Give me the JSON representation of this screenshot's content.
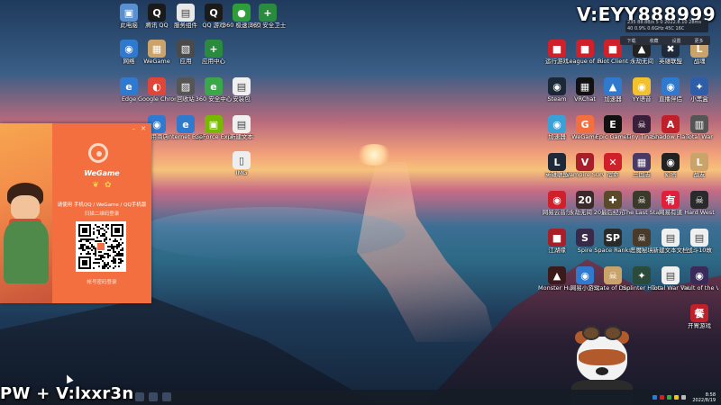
{
  "overlays": {
    "top_right": "V:EYY888999",
    "bottom_left": "PW + V:lxxr3n"
  },
  "speedbar": {
    "line1": "235 88.8B/s 5 0  2022.8.10  28ms",
    "line2": "40 0.9%   0.6GHz  45C  16C"
  },
  "dropbar": {
    "items": [
      "下载",
      "收藏",
      "设置",
      "更多"
    ]
  },
  "desktop_left": [
    {
      "label": "此电脑",
      "color": "#5a8fd0",
      "glyph": "▣"
    },
    {
      "label": "腾讯 QQ",
      "color": "#1a1a1a",
      "glyph": "Q"
    },
    {
      "label": "服务组件",
      "color": "#e8e8e8",
      "glyph": "▤"
    },
    {
      "label": "QQ 游戏",
      "color": "#1a1a1a",
      "glyph": "Q"
    },
    {
      "label": "360 极速浏览器",
      "color": "#2e9e3a",
      "glyph": "●"
    },
    {
      "label": "360 安全卫士",
      "color": "#2a8b3e",
      "glyph": "+"
    },
    {
      "label": "网络",
      "color": "#2f79cf",
      "glyph": "◉"
    },
    {
      "label": "WeGame",
      "color": "#c9a36a",
      "glyph": "▦"
    },
    {
      "label": "应用",
      "color": "#4a4a4a",
      "glyph": "▧"
    },
    {
      "label": "应用中心",
      "color": "#2a8b3e",
      "glyph": "+"
    },
    {
      "label": "Edge",
      "color": "#2f79cf",
      "glyph": "e"
    },
    {
      "label": "Google Chrome",
      "color": "#e0453a",
      "glyph": "◐"
    },
    {
      "label": "回收站",
      "color": "#555",
      "glyph": "▨"
    },
    {
      "label": "360 安全中心",
      "color": "#3aa84a",
      "glyph": "e"
    },
    {
      "label": "安装包",
      "color": "#f0f0f0",
      "glyph": "▤"
    },
    {
      "label": "应用商店",
      "color": "#2f79cf",
      "glyph": "◉"
    },
    {
      "label": "Internet Explorer",
      "color": "#2f79cf",
      "glyph": "e"
    },
    {
      "label": "GeForce Experience",
      "color": "#76b900",
      "glyph": "▣"
    },
    {
      "label": "新建文本",
      "color": "#f0f0f0",
      "glyph": "▤"
    },
    {
      "label": "IMG",
      "color": "#eee",
      "glyph": "▯"
    }
  ],
  "desktop_right": [
    {
      "label": "运行游戏",
      "color": "#d0202a",
      "glyph": "■"
    },
    {
      "label": "League of Legends",
      "color": "#d0202a",
      "glyph": "■"
    },
    {
      "label": "Riot Client",
      "color": "#d0202a",
      "glyph": "■"
    },
    {
      "label": "永劫无间",
      "color": "#222",
      "glyph": "▲"
    },
    {
      "label": "英雄联盟",
      "color": "#1e2a3a",
      "glyph": "✖"
    },
    {
      "label": "战魂",
      "color": "#c9a36a",
      "glyph": "L"
    },
    {
      "label": "Steam",
      "color": "#1b2838",
      "glyph": "◉"
    },
    {
      "label": "VRChat",
      "color": "#111",
      "glyph": "▦"
    },
    {
      "label": "加速器",
      "color": "#2f79cf",
      "glyph": "▲"
    },
    {
      "label": "YY语音",
      "color": "#f2c12e",
      "glyph": "◉"
    },
    {
      "label": "直播伴侣",
      "color": "#2f79cf",
      "glyph": "◉"
    },
    {
      "label": "小黑盒",
      "color": "#2f5ea8",
      "glyph": "✦"
    },
    {
      "label": "加速器",
      "color": "#3aa0d8",
      "glyph": "◉"
    },
    {
      "label": "WeGame",
      "color": "#f46f3f",
      "glyph": "G"
    },
    {
      "label": "Epic Games",
      "color": "#111",
      "glyph": "E"
    },
    {
      "label": "Tiny Tina's",
      "color": "#3a1f3a",
      "glyph": "☠"
    },
    {
      "label": "Shadow Flare",
      "color": "#c0202a",
      "glyph": "A"
    },
    {
      "label": "Total War",
      "color": "#555",
      "glyph": "▥"
    },
    {
      "label": "英雄联盟",
      "color": "#1e2a3a",
      "glyph": "L"
    },
    {
      "label": "Vampire Survivors",
      "color": "#a81f2a",
      "glyph": "V"
    },
    {
      "label": "宿命",
      "color": "#d0202a",
      "glyph": "✕"
    },
    {
      "label": "三国志",
      "color": "#4a3a66",
      "glyph": "▦"
    },
    {
      "label": "幻塔",
      "color": "#222",
      "glyph": "◉"
    },
    {
      "label": "战友",
      "color": "#c9a36a",
      "glyph": "L"
    },
    {
      "label": "网易云音乐",
      "color": "#d0202a",
      "glyph": "◉"
    },
    {
      "label": "永劫无间 20",
      "color": "#3a2a2a",
      "glyph": "20"
    },
    {
      "label": "最后纪元",
      "color": "#5a4a2a",
      "glyph": "✚"
    },
    {
      "label": "The Last Stand",
      "color": "#3a3a2a",
      "glyph": "☠"
    },
    {
      "label": "网易有道",
      "color": "#e0203a",
      "glyph": "有"
    },
    {
      "label": "Hard West",
      "color": "#2a2a2a",
      "glyph": "☠"
    },
    {
      "label": "江湖缘",
      "color": "#a81f2a",
      "glyph": "■"
    },
    {
      "label": "Spire",
      "color": "#3a2a4a",
      "glyph": "S"
    },
    {
      "label": "Space Ranks",
      "color": "#2a2a2a",
      "glyph": "SP"
    },
    {
      "label": "恶魔秘境",
      "color": "#4a3a2a",
      "glyph": "☠"
    },
    {
      "label": "新建文本文档",
      "color": "#f0f0f0",
      "glyph": "▤"
    },
    {
      "label": "战斗10故",
      "color": "#f0f0f0",
      "glyph": "▤"
    },
    {
      "label": "Monster Hunter",
      "color": "#3a1a1a",
      "glyph": "▲"
    },
    {
      "label": "网易小游戏",
      "color": "#2f79cf",
      "glyph": "◉"
    },
    {
      "label": "State of Decay 2",
      "color": "#c9a36a",
      "glyph": "☠"
    },
    {
      "label": "Splinter Hunter",
      "color": "#2a4a3a",
      "glyph": "✦"
    },
    {
      "label": "Total War THREE",
      "color": "#f0f0f0",
      "glyph": "▤"
    },
    {
      "label": "Vault of the Void",
      "color": "#3a2a5a",
      "glyph": "◉"
    },
    {
      "label": "开胃游戏",
      "color": "#c0202a",
      "glyph": "餐"
    }
  ],
  "wegame": {
    "brand": "WeGame",
    "login_hint": "请使用 手机QQ / WeGame / QQ手机版",
    "scan_hint": "扫描二维码登录",
    "footer": "帐号密码登录",
    "min_glyph": "–",
    "close_glyph": "✕",
    "socials": [
      "❦",
      "✿"
    ]
  },
  "taskbar": {
    "time": "8:58",
    "date": "2022/8/19"
  }
}
